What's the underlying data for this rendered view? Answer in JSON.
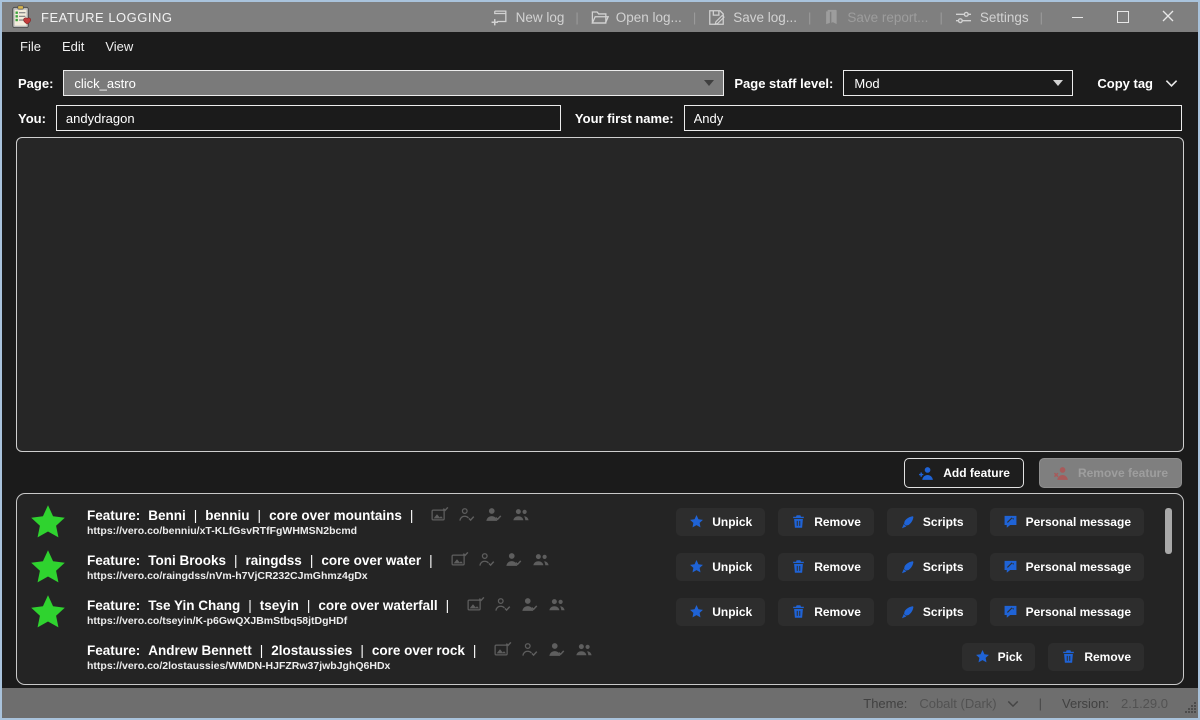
{
  "ui": {
    "separator": "|",
    "feature_label": "Feature:",
    "status_icons": [
      "photo-check-icon",
      "user-check-outline-icon",
      "user-check-filled-icon",
      "users-group-icon"
    ]
  },
  "window": {
    "title": "FEATURE LOGGING",
    "controls": [
      "minimize",
      "maximize",
      "close"
    ]
  },
  "toolbar": {
    "buttons": [
      {
        "name": "new-log-button",
        "icon": "newlog",
        "label": "New log",
        "enabled": true
      },
      {
        "name": "open-log-button",
        "icon": "openlog",
        "label": "Open log...",
        "enabled": true
      },
      {
        "name": "save-log-button",
        "icon": "savelog",
        "label": "Save log...",
        "enabled": true
      },
      {
        "name": "save-report-button",
        "icon": "savereport",
        "label": "Save report...",
        "enabled": false
      },
      {
        "name": "settings-button",
        "icon": "settings",
        "label": "Settings",
        "enabled": true
      }
    ]
  },
  "menubar": {
    "items": [
      {
        "name": "menu-file",
        "label": "File"
      },
      {
        "name": "menu-edit",
        "label": "Edit"
      },
      {
        "name": "menu-view",
        "label": "View"
      }
    ]
  },
  "form": {
    "page": {
      "label": "Page:",
      "value": "click_astro"
    },
    "staff_level": {
      "label": "Page staff level:",
      "value": "Mod"
    },
    "copy_tag": {
      "label": "Copy tag"
    },
    "you": {
      "label": "You:",
      "value": "andydragon"
    },
    "first_name": {
      "label": "Your first name:",
      "value": "Andy"
    }
  },
  "actions": {
    "add_feature": {
      "label": "Add feature",
      "enabled": true
    },
    "remove_feature": {
      "label": "Remove feature",
      "enabled": false
    }
  },
  "features": [
    {
      "picked": true,
      "name": "Benni",
      "alias": "benniu",
      "description": "core over mountains",
      "url": "https://vero.co/benniu/xT-KLfGsvRTfFgWHMSN2bcmd",
      "buttons": [
        {
          "name": "unpick-button",
          "icon": "star",
          "label": "Unpick"
        },
        {
          "name": "remove-button",
          "icon": "trash",
          "label": "Remove"
        },
        {
          "name": "scripts-button",
          "icon": "scripts",
          "label": "Scripts"
        },
        {
          "name": "personal-message-button",
          "icon": "message",
          "label": "Personal message"
        }
      ]
    },
    {
      "picked": true,
      "name": "Toni Brooks",
      "alias": "raingdss",
      "description": "core over water",
      "url": "https://vero.co/raingdss/nVm-h7VjCR232CJmGhmz4gDx",
      "buttons": [
        {
          "name": "unpick-button",
          "icon": "star",
          "label": "Unpick"
        },
        {
          "name": "remove-button",
          "icon": "trash",
          "label": "Remove"
        },
        {
          "name": "scripts-button",
          "icon": "scripts",
          "label": "Scripts"
        },
        {
          "name": "personal-message-button",
          "icon": "message",
          "label": "Personal message"
        }
      ]
    },
    {
      "picked": true,
      "name": "Tse Yin Chang",
      "alias": "tseyin",
      "description": "core over waterfall",
      "url": "https://vero.co/tseyin/K-p6GwQXJBmStbq58jtDgHDf",
      "buttons": [
        {
          "name": "unpick-button",
          "icon": "star",
          "label": "Unpick"
        },
        {
          "name": "remove-button",
          "icon": "trash",
          "label": "Remove"
        },
        {
          "name": "scripts-button",
          "icon": "scripts",
          "label": "Scripts"
        },
        {
          "name": "personal-message-button",
          "icon": "message",
          "label": "Personal message"
        }
      ]
    },
    {
      "picked": false,
      "name": "Andrew Bennett",
      "alias": "2lostaussies",
      "description": "core over rock",
      "url": "https://vero.co/2lostaussies/WMDN-HJFZRw37jwbJghQ6HDx",
      "buttons": [
        {
          "name": "pick-button",
          "icon": "star",
          "label": "Pick"
        },
        {
          "name": "remove-button",
          "icon": "trash",
          "label": "Remove"
        }
      ]
    }
  ],
  "statusbar": {
    "theme_label": "Theme:",
    "theme_value": "Cobalt (Dark)",
    "version_label": "Version:",
    "version_value": "2.1.29.0"
  },
  "colors": {
    "titlebar_bg": "#7f7f7f",
    "app_bg": "#1b1b1b",
    "panel_bg": "#262626",
    "statusbar_bg": "#6e6e6e",
    "accent_blue": "#1f63d6",
    "picked_green": "#2fd32f",
    "disabled_red": "#a85a5a"
  }
}
